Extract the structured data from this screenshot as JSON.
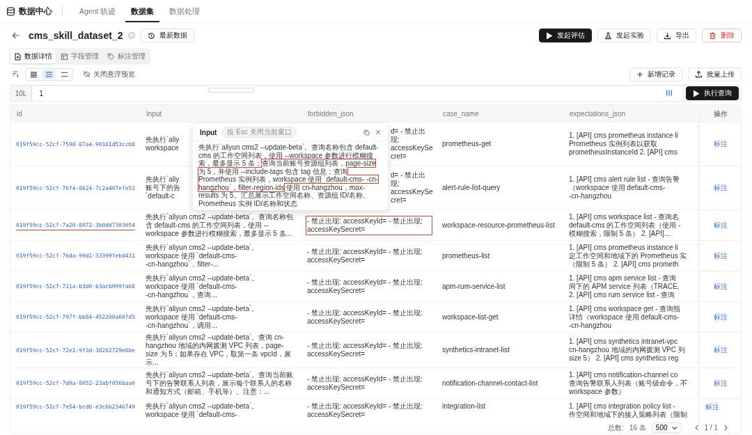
{
  "nav": {
    "brand": "数据中心",
    "tabs": [
      {
        "label": "Agent 轨迹",
        "selected": false
      },
      {
        "label": "数据集",
        "selected": true
      },
      {
        "label": "数据处理",
        "selected": false
      }
    ]
  },
  "header": {
    "title": "cms_skill_dataset_2",
    "latest_button": "最新数据",
    "actions": [
      {
        "label": "发起评估",
        "kind": "primary"
      },
      {
        "label": "发起实验",
        "kind": "default"
      },
      {
        "label": "导出",
        "kind": "default"
      },
      {
        "label": "删除",
        "kind": "danger"
      }
    ]
  },
  "view_tabs": [
    {
      "label": "数据详情",
      "selected": true
    },
    {
      "label": "字段管理",
      "selected": false
    },
    {
      "label": "标注管理",
      "selected": false
    }
  ],
  "toolbar": {
    "density": [
      {
        "selected": false
      },
      {
        "selected": true
      },
      {
        "selected": false
      }
    ],
    "preview_toggle": "关闭悬浮预览",
    "actions": [
      "新增记录",
      "批量上传"
    ]
  },
  "query": {
    "lines_label": "10L",
    "line_number": "1",
    "run_button": "执行查询"
  },
  "table": {
    "columns": [
      "id",
      "Input",
      "forbidden_json",
      "case_name",
      "expectations_json",
      "操作"
    ],
    "rows": [
      {
        "id": "019f59cc-52cf-7598-87a4-90161d53ccb8",
        "input": [
          "先执行`aliy",
          "workspace"
        ],
        "forbidden": "d= - 禁止出现: accessKeySecret=",
        "case_name": "prometheus-get",
        "expectations": [
          "1. [API] cms prometheus instance li",
          "Prometheus 实例列表以获取",
          "prometheusInstanceId 2. [API] cms"
        ],
        "action": "标注",
        "covered": true,
        "highlighted": false
      },
      {
        "id": "019f59cc-52cf-70f4-8624-7c2a407efe53",
        "input": [
          "先执行`aliy",
          "账号下的告",
          "`default-c"
        ],
        "forbidden": "d= - 禁止出现: accessKeySecret=",
        "case_name": "alert-rule-list-query",
        "expectations": [
          "1. [API] cms alert rule list - 查询告警",
          "（workspace 使用 default-cms-",
          "-cn-hangzhou"
        ],
        "action": "标注",
        "covered": true,
        "highlighted": false
      },
      {
        "id": "019f59cc-52cf-7a20-8972-3b0dd7303054",
        "input": [
          "先执行`aliyun cms2 --update-beta`。查询名称包含 default-cms 的工作空间列表，使用 --workspace 参数进行模糊搜索，最多显示 5 条..."
        ],
        "forbidden": "- 禁止出现: accessKeyId= - 禁止出现: accessKeySecret=",
        "case_name": "workspace-resource-prometheus-list",
        "expectations": [
          "1. [API] cms workspace list - 查询名",
          "default-cms 的工作空间列表（使用 -",
          "模糊搜索，限制 5 条） 2. [API]..."
        ],
        "action": "标注",
        "covered": false,
        "highlighted": true
      },
      {
        "id": "019f59cc-52cf-76da-90d1-33399febd431",
        "input": [
          "先执行`aliyun cms2 --update-beta`。",
          "workspace 使用 `default-cms-",
          "-cn-hangzhou`，filter-..."
        ],
        "forbidden": "- 禁止出现: accessKeyId= - 禁止出现: accessKeySecret=",
        "case_name": "prometheus-list",
        "expectations": [
          "1. [API] cms prometheus instance li",
          "定工作空间和地域下的 Prometheus 实",
          "（限制 5 条） 2. [API] cms prometh"
        ],
        "action": "标注",
        "covered": false,
        "highlighted": false
      },
      {
        "id": "019f59cc-52cf-711a-b3d0-b3acb099fa68",
        "input": [
          "先执行`aliyun cms2 --update-beta`。",
          "workspace 使用 `default-cms-",
          "-cn-hangzhou`，查询..."
        ],
        "forbidden": "- 禁止出现: accessKeyId= - 禁止出现: accessKeySecret=",
        "case_name": "apm-rum-service-list",
        "expectations": [
          "1. [API] cms apm service list - 查询",
          "间下的 APM service 列表（TRACE,",
          "2. [API] cms rum service list - 查询"
        ],
        "action": "标注",
        "covered": false,
        "highlighted": false
      },
      {
        "id": "019f59cc-52cf-797f-bb84-452200a60fd3",
        "input": [
          "先执行`aliyun cms2 --update-beta`。",
          "workspace 使用 `default-cms-",
          "-cn-hangzhou`，调用..."
        ],
        "forbidden": "- 禁止出现: accessKeyId= - 禁止出现: accessKeySecret=",
        "case_name": "workspace-list-get",
        "expectations": [
          "1. [API] cms workspace get - 查询指",
          "详情（workspace 使用 default-cms-",
          "-cn-hangzhou"
        ],
        "action": "标注",
        "covered": false,
        "highlighted": false
      },
      {
        "id": "019f59cc-52cf-72e1-9f3d-38262729e6be",
        "input": [
          "先执行`aliyun cms2 --update-beta`。查询 cn-hangzhou 地域的内网拨测 VPC 列表，page-size 为 5；如果存在 VPC，取第一条 vpcId，展示..."
        ],
        "forbidden": "- 禁止出现: accessKeyId= - 禁止出现: accessKeySecret=",
        "case_name": "synthetics-intranet-list",
        "expectations": [
          "1. [API] cms synthetics intranet-vpc",
          "cn-hangzhou 地域的内网拨测 VPC 列",
          "size 5） 2. [API] cms synthetics reg"
        ],
        "action": "标注",
        "covered": false,
        "highlighted": false
      },
      {
        "id": "019f59cc-52cf-7d0a-8052-23abf056baa0",
        "input": [
          "先执行`aliyun cms2 --update-beta`。查询当前账号下的告警联系人列表，展示每个联系人的名称和通知方式（邮箱、手机等）。注意：..."
        ],
        "forbidden": "- 禁止出现: accessKeyId= - 禁止出现: accessKeySecret=",
        "case_name": "notification-channel-contact-list",
        "expectations": [
          "1. [API] cms notification-channel co",
          "查询告警联系人列表（账号级命令，不",
          "workspace 参数）"
        ],
        "action": "标注",
        "covered": false,
        "highlighted": false
      },
      {
        "id": "019f59cc-52cf-7e54-bcdb-e3c6b2346749",
        "input": [
          "先执行`aliyun cms2 --update-beta`。",
          "workspace 使用 `default-cms-"
        ],
        "forbidden": "- 禁止出现: accessKeyId= - 禁止出现: accessKeySecret=",
        "case_name": "integration-list",
        "expectations": [
          "1. [API] cms integration policy list -",
          "作空间和地域下的接入策略列表（限制"
        ],
        "action": "标注",
        "covered": false,
        "highlighted": false
      }
    ],
    "popup": {
      "title": "Input",
      "hint": "按 Esc 关闭当前窗口",
      "segments": [
        {
          "text": "先执行`aliyun cms2 --update-beta`。查询名称包含 default-cms 的工作空间列表，使用 --workspace 参数进行模糊搜索，最多显示 5 条；",
          "highlighted": false
        },
        {
          "text": "查询当前账号资源组列表，page-size 为 5，并使用 --include-tags 包含 tag 信息；查询 Prometheus 实例列表，workspace 使用 `default-cms-    -cn-hangzhou`，filter-region-ids",
          "highlighted": true
        },
        {
          "text": " 使用 cn-hangzhou，max-results 为 5。汇总展示工作空间名称、资源组 ID/名称、Prometheus 实例 ID/名称和状态",
          "highlighted": false
        }
      ]
    },
    "footer": {
      "total_label": "总数:",
      "total": "16 条",
      "page_size": "500",
      "page": "1 / 1"
    }
  }
}
